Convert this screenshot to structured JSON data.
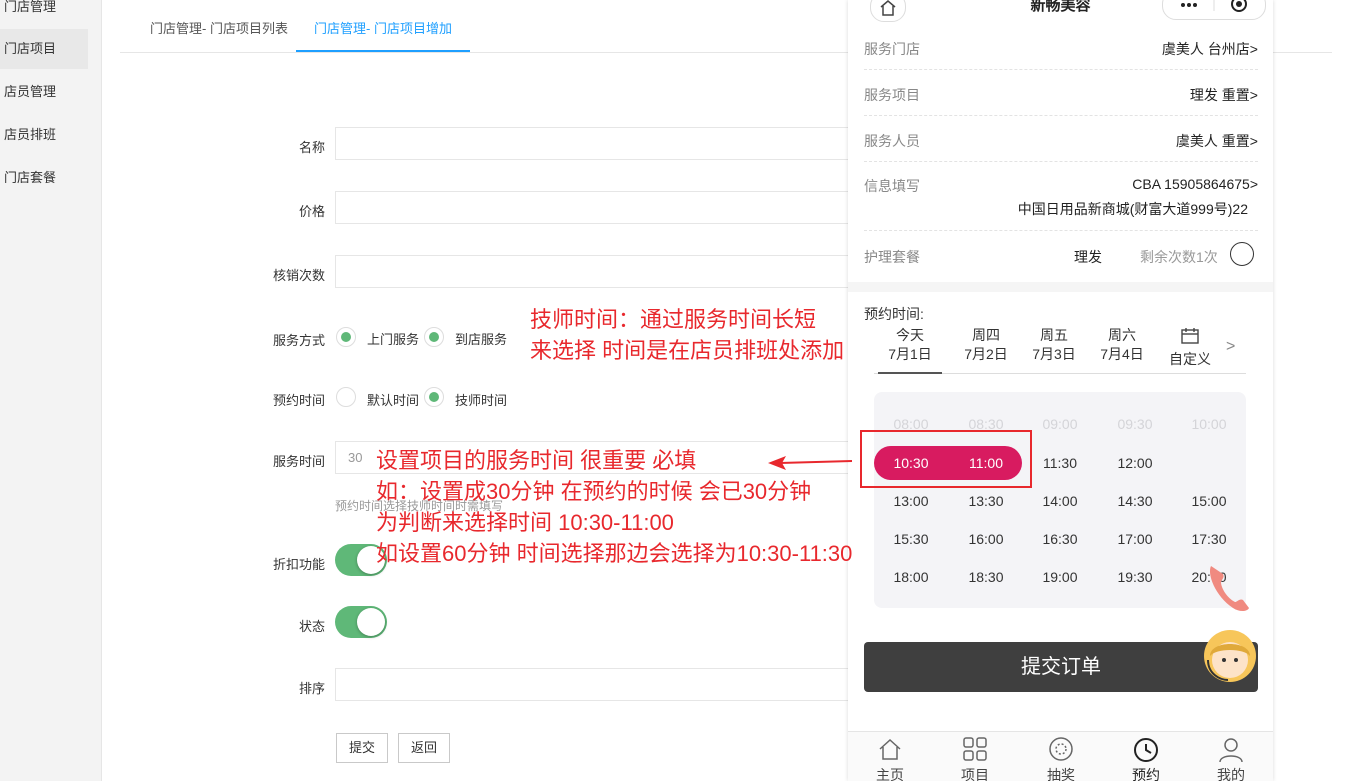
{
  "sidebar": {
    "items": [
      {
        "label": "门店管理"
      },
      {
        "label": "门店项目"
      },
      {
        "label": "店员管理"
      },
      {
        "label": "店员排班"
      },
      {
        "label": "门店套餐"
      }
    ]
  },
  "tabs": [
    {
      "label": "门店管理- 门店项目列表"
    },
    {
      "label": "门店管理- 门店项目增加"
    }
  ],
  "form": {
    "name_label": "名称",
    "price_label": "价格",
    "verify_label": "核销次数",
    "service_mode_label": "服务方式",
    "service_mode_options": [
      "上门服务",
      "到店服务"
    ],
    "booking_time_label": "预约时间",
    "booking_time_options": [
      "默认时间",
      "技师时间"
    ],
    "service_time_label": "服务时间",
    "service_time_value": "30",
    "service_time_hint": "预约时间选择技师时间时需填写",
    "discount_label": "折扣功能",
    "status_label": "状态",
    "sort_label": "排序",
    "submit_label": "提交",
    "back_label": "返回"
  },
  "annotations": {
    "tech_line1": "技师时间：通过服务时间长短",
    "tech_line2": "来选择  时间是在店员排班处添加",
    "svc_line1": "设置项目的服务时间 很重要 必填",
    "svc_line2": "如：设置成30分钟 在预约的时候 会已30分钟",
    "svc_line3": "为判断来选择时间 10:30-11:00",
    "svc_line4": "如设置60分钟 时间选择那边会选择为10:30-11:30"
  },
  "phone": {
    "title": "新畅美容",
    "rows": [
      {
        "key": "服务门店",
        "value": "虞美人 台州店>"
      },
      {
        "key": "服务项目",
        "value": "理发 重置>"
      },
      {
        "key": "服务人员",
        "value": "虞美人 重置>"
      }
    ],
    "info": {
      "key": "信息填写",
      "line1": "CBA 15905864675>",
      "line2": "中国日用品新商城(财富大道999号)22"
    },
    "package": {
      "key": "护理套餐",
      "name": "理发",
      "remaining": "剩余次数1次"
    },
    "booking_label": "预约时间:",
    "days": [
      {
        "top": "今天",
        "bottom": "7月1日"
      },
      {
        "top": "周四",
        "bottom": "7月2日"
      },
      {
        "top": "周五",
        "bottom": "7月3日"
      },
      {
        "top": "周六",
        "bottom": "7月4日"
      },
      {
        "top": "",
        "bottom": "自定义"
      }
    ],
    "next_arrow": ">",
    "slots": [
      "08:00",
      "08:30",
      "09:00",
      "09:30",
      "10:00",
      "10:30",
      "11:00",
      "11:30",
      "12:00",
      "13:00",
      "13:30",
      "14:00",
      "14:30",
      "15:00",
      "15:30",
      "16:00",
      "16:30",
      "17:00",
      "17:30",
      "18:00",
      "18:30",
      "19:00",
      "19:30",
      "20:00"
    ],
    "submit_label": "提交订单",
    "tabbar": [
      {
        "label": "主页",
        "icon": "home-icon"
      },
      {
        "label": "项目",
        "icon": "grid-icon"
      },
      {
        "label": "抽奖",
        "icon": "lottery-icon"
      },
      {
        "label": "预约",
        "icon": "clock-icon"
      },
      {
        "label": "我的",
        "icon": "user-icon"
      }
    ]
  },
  "colors": {
    "accent": "#1e9fff",
    "green": "#5fb878",
    "annotation": "#e8282d",
    "selected_slot": "#d81b60"
  }
}
